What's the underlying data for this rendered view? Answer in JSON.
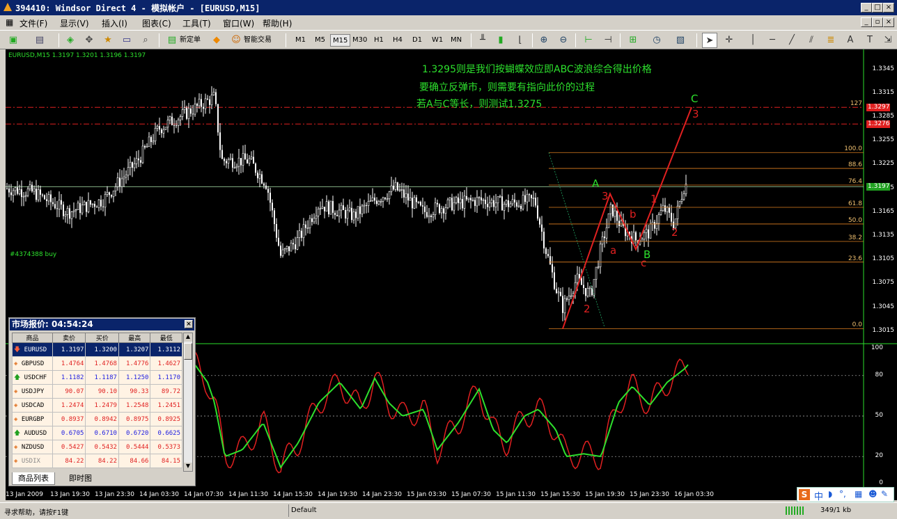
{
  "window": {
    "title": "394410: Windsor Direct 4 - 模拟帐户 - [EURUSD,M15]",
    "controls": [
      "_",
      "□",
      "×"
    ]
  },
  "menu": [
    "文件(F)",
    "显示(V)",
    "插入(I)",
    "图表(C)",
    "工具(T)",
    "窗口(W)",
    "帮助(H)"
  ],
  "toolbar": {
    "new_order": "新定单",
    "expert": "智能交易",
    "timeframes": [
      "M1",
      "M5",
      "M15",
      "M30",
      "H1",
      "H4",
      "D1",
      "W1",
      "MN"
    ],
    "selected_timeframe": "M15"
  },
  "chart": {
    "header": "EURUSD,M15  1.3197 1.3201 1.3196 1.3197",
    "order_label": "#4374388 buy",
    "annotations": [
      "1.3295则是我们按蝴蝶效应即ABC波浪综合得出价格",
      "要确立反弹市，则需要有指向此价的过程",
      "若A与C等长，则测试1.3275"
    ],
    "price_axis": [
      "1.3345",
      "1.3315",
      "1.3285",
      "1.3255",
      "1.3225",
      "1.3195",
      "1.3165",
      "1.3135",
      "1.3105",
      "1.3075",
      "1.3045",
      "1.3015"
    ],
    "price_tags": [
      {
        "text": "1.3297",
        "color": "#e02020"
      },
      {
        "text": "1.3276",
        "color": "#e02020"
      },
      {
        "text": "1.3197",
        "color": "#20a020"
      }
    ],
    "fib_levels": [
      "127",
      "100.0",
      "88.6",
      "76.4",
      "61.8",
      "50.0",
      "38.2",
      "23.6",
      "0.0"
    ],
    "wave_labels": [
      {
        "text": "A",
        "color": "#2de02d"
      },
      {
        "text": "B",
        "color": "#2de02d"
      },
      {
        "text": "C",
        "color": "#2de02d"
      },
      {
        "text": "3",
        "color": "#e02020"
      },
      {
        "text": "3",
        "color": "#e02020"
      },
      {
        "text": "2",
        "color": "#e02020"
      },
      {
        "text": "2",
        "color": "#e02020"
      },
      {
        "text": "a",
        "color": "#e02020"
      },
      {
        "text": "b",
        "color": "#e02020"
      },
      {
        "text": "c",
        "color": "#e02020"
      },
      {
        "text": "1",
        "color": "#e02020"
      }
    ],
    "osc_axis": [
      "100",
      "80",
      "50",
      "20",
      "0"
    ],
    "time_axis": [
      "13 Jan 2009",
      "13 Jan 19:30",
      "13 Jan 23:30",
      "14 Jan 03:30",
      "14 Jan 07:30",
      "14 Jan 11:30",
      "14 Jan 15:30",
      "14 Jan 19:30",
      "14 Jan 23:30",
      "15 Jan 03:30",
      "15 Jan 07:30",
      "15 Jan 11:30",
      "15 Jan 15:30",
      "15 Jan 19:30",
      "15 Jan 23:30",
      "16 Jan 03:30"
    ]
  },
  "market_watch": {
    "title": "市场报价: 04:54:24",
    "columns": [
      "商品",
      "卖价",
      "买价",
      "最高",
      "最低"
    ],
    "rows": [
      {
        "symbol": "EURUSD",
        "bid": "1.3197",
        "ask": "1.3200",
        "high": "1.3207",
        "low": "1.3112",
        "dir": "down",
        "color": "#ffffff"
      },
      {
        "symbol": "GBPUSD",
        "bid": "1.4764",
        "ask": "1.4768",
        "high": "1.4776",
        "low": "1.4627",
        "dir": "diamond",
        "color": "#e02020"
      },
      {
        "symbol": "USDCHF",
        "bid": "1.1182",
        "ask": "1.1187",
        "high": "1.1250",
        "low": "1.1170",
        "dir": "up",
        "color": "#2020e0"
      },
      {
        "symbol": "USDJPY",
        "bid": "90.07",
        "ask": "90.10",
        "high": "90.33",
        "low": "89.72",
        "dir": "diamond",
        "color": "#e02020"
      },
      {
        "symbol": "USDCAD",
        "bid": "1.2474",
        "ask": "1.2479",
        "high": "1.2548",
        "low": "1.2451",
        "dir": "diamond",
        "color": "#e02020"
      },
      {
        "symbol": "EURGBP",
        "bid": "0.8937",
        "ask": "0.8942",
        "high": "0.8975",
        "low": "0.8925",
        "dir": "diamond",
        "color": "#e02020"
      },
      {
        "symbol": "AUDUSD",
        "bid": "0.6705",
        "ask": "0.6710",
        "high": "0.6720",
        "low": "0.6625",
        "dir": "up",
        "color": "#2020e0"
      },
      {
        "symbol": "NZDUSD",
        "bid": "0.5427",
        "ask": "0.5432",
        "high": "0.5444",
        "low": "0.5373",
        "dir": "diamond",
        "color": "#e02020"
      },
      {
        "symbol": "USDIX",
        "bid": "84.22",
        "ask": "84.22",
        "high": "84.66",
        "low": "84.15",
        "dir": "diamond",
        "color": "#e02020"
      }
    ],
    "tabs": [
      "商品列表",
      "即时图"
    ]
  },
  "statusbar": {
    "help": "寻求帮助，请按F1键",
    "profile": "Default",
    "traffic": "349/1 kb"
  },
  "ime": "中"
}
